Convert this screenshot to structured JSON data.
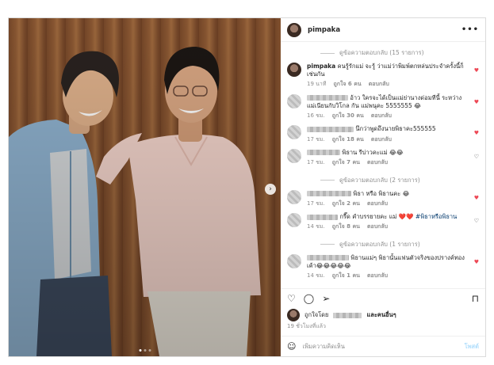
{
  "post": {
    "username": "pimpaka",
    "more_label": "•••"
  },
  "media": {
    "next_arrow": "›",
    "slides": 3,
    "active_slide": 1
  },
  "comments": [
    {
      "type": "view_replies",
      "label": "ดูข้อความตอบกลับ (15 รายการ)"
    },
    {
      "type": "comment",
      "owner": true,
      "username": "pimpaka",
      "text": "คนรู้รักแม่ จะรู้ ว่าแม่ว่าพิมพ์ตกหล่นประจำครั้งนี้ก็เช่นกัน",
      "time": "19 นาที",
      "likes": "ถูกใจ 6 คน",
      "reply": "ตอบกลับ",
      "liked": true
    },
    {
      "type": "comment",
      "username_hidden": true,
      "text": "อ้าว ใครจะได้เป็นแม่ย่านางด่อมทีนี้ ระหว่างแม่เนียนกับวิโกล กัน แม่พนุคะ 5555555 😂",
      "time": "16 ชม.",
      "likes": "ถูกใจ 30 คน",
      "reply": "ตอบกลับ",
      "liked": true
    },
    {
      "type": "comment",
      "username_hidden": true,
      "text": "นึกว่าพูดถึงนายพิธาคะ555555",
      "time": "17 ชม.",
      "likes": "ถูกใจ 18 คน",
      "reply": "ตอบกลับ",
      "liked": true
    },
    {
      "type": "comment",
      "username_hidden": true,
      "text": "พิธาน รีบ่าวคะแม่ 😂😂",
      "time": "17 ชม.",
      "likes": "ถูกใจ 7 คน",
      "reply": "ตอบกลับ",
      "liked": false
    },
    {
      "type": "view_replies",
      "label": "ดูข้อความตอบกลับ (2 รายการ)"
    },
    {
      "type": "comment",
      "username_hidden": true,
      "text": "พิธา หรือ พิธานคะ 😂",
      "time": "17 ชม.",
      "likes": "ถูกใจ 2 คน",
      "reply": "ตอบกลับ",
      "liked": true
    },
    {
      "type": "comment",
      "username_hidden": true,
      "text": "กรี๊ด คำบรรยายคะ แม่ ❤️❤️",
      "tag": "#พิธาหรือพิธาน",
      "time": "14 ชม.",
      "likes": "ถูกใจ 8 คน",
      "reply": "ตอบกลับ",
      "liked": false
    },
    {
      "type": "view_replies",
      "label": "ดูข้อความตอบกลับ (1 รายการ)"
    },
    {
      "type": "comment",
      "username_hidden": true,
      "text": "พิธานแม่ๆ พิธานั้นแฟนตัวจริงของปรางค์ทองเค้า😂😂😂😂😂",
      "time": "14 ชม.",
      "likes": "ถูกใจ 1 คน",
      "reply": "ตอบกลับ",
      "liked": true
    }
  ],
  "actions": {
    "like_icon": "♡",
    "comment_icon": "◯",
    "share_icon": "➢",
    "save_icon": "⊓"
  },
  "likes_line": {
    "prefix": "ถูกใจโดย",
    "suffix": "และคนอื่นๆ"
  },
  "timestamp": "19 ชั่วโมงที่แล้ว",
  "add_comment": {
    "emoji": "☺",
    "placeholder": "เพิ่มความคิดเห็น",
    "post_label": "โพสต์"
  },
  "colors": {
    "heart_red": "#ed4956",
    "post_button_disabled": "#b2dffc",
    "muted_text": "#8e8e8e"
  }
}
